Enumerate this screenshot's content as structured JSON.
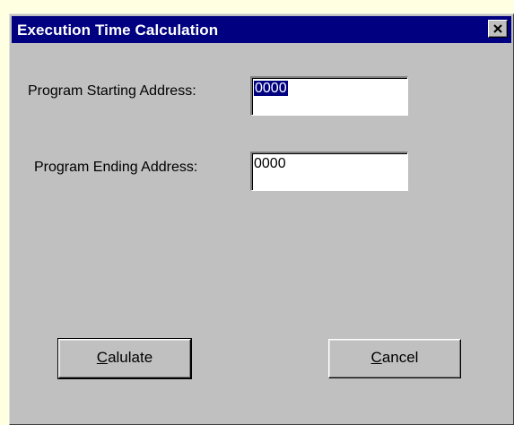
{
  "dialog": {
    "title": "Execution Time Calculation",
    "close_label": "Close"
  },
  "fields": {
    "start": {
      "label": "Program Starting Address:",
      "value": "0000",
      "selected": true
    },
    "end": {
      "label": "Program Ending Address:",
      "value": "0000"
    }
  },
  "buttons": {
    "calculate": {
      "mnemonic": "C",
      "rest": "alulate"
    },
    "cancel": {
      "mnemonic": "C",
      "rest": "ancel"
    }
  },
  "icons": {
    "close": "close-icon"
  },
  "colors": {
    "titlebar": "#000080",
    "dialog_bg": "#c0c0c0",
    "page_bg": "#ffffe1",
    "selection": "#000080"
  }
}
